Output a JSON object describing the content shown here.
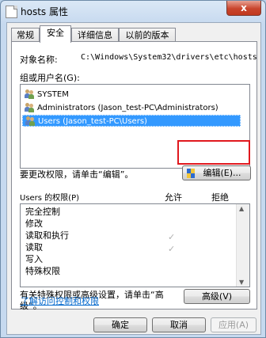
{
  "window": {
    "title": "hosts 属性",
    "close_label": "x"
  },
  "tabs": [
    {
      "label": "常规",
      "active": false
    },
    {
      "label": "安全",
      "active": true
    },
    {
      "label": "详细信息",
      "active": false
    },
    {
      "label": "以前的版本",
      "active": false
    }
  ],
  "object": {
    "label": "对象名称:",
    "value": "C:\\Windows\\System32\\drivers\\etc\\hosts"
  },
  "groups": {
    "label": "组或用户名(G):",
    "items": [
      {
        "name": "SYSTEM",
        "selected": false
      },
      {
        "name": "Administrators (Jason_test-PC\\Administrators)",
        "selected": false
      },
      {
        "name": "Users (Jason_test-PC\\Users)",
        "selected": true
      }
    ]
  },
  "change_hint": "要更改权限，请单击“编辑”。",
  "edit_button": "编辑(E)...",
  "permissions": {
    "label": "Users 的权限(P)",
    "allow_label": "允许",
    "deny_label": "拒绝",
    "rows": [
      {
        "name": "完全控制",
        "allow": false,
        "deny": false
      },
      {
        "name": "修改",
        "allow": false,
        "deny": false
      },
      {
        "name": "读取和执行",
        "allow": true,
        "deny": false
      },
      {
        "name": "读取",
        "allow": true,
        "deny": false
      },
      {
        "name": "写入",
        "allow": false,
        "deny": false
      },
      {
        "name": "特殊权限",
        "allow": false,
        "deny": false
      }
    ],
    "check_glyph": "✓"
  },
  "advanced": {
    "hint_line1": "有关特殊权限或高级设置，请单击“高",
    "hint_line2": "级”。",
    "button": "高级(V)"
  },
  "learn_link": "了解访问控制和权限",
  "footer": {
    "ok": "确定",
    "cancel": "取消",
    "apply": "应用(A)"
  },
  "colors": {
    "selection": "#3399ff",
    "highlight_box": "#e0181e",
    "link": "#0066cc"
  }
}
